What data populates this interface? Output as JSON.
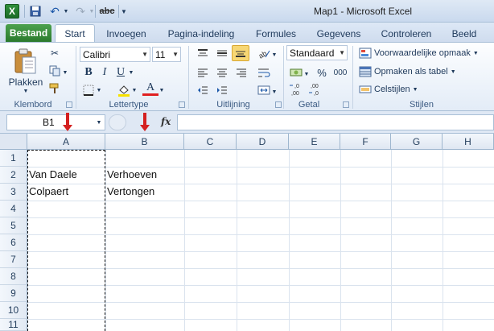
{
  "window": {
    "title": "Map1  -  Microsoft Excel",
    "app_icon_letter": "X"
  },
  "quick_access": {
    "undo_glyph": "↶",
    "redo_glyph": "↷",
    "spell_label": "abc"
  },
  "tabs": [
    {
      "label": "Bestand",
      "kind": "file"
    },
    {
      "label": "Start",
      "active": true
    },
    {
      "label": "Invoegen"
    },
    {
      "label": "Pagina-indeling"
    },
    {
      "label": "Formules"
    },
    {
      "label": "Gegevens"
    },
    {
      "label": "Controleren"
    },
    {
      "label": "Beeld"
    }
  ],
  "ribbon": {
    "clipboard": {
      "paste_label": "Plakken",
      "group_label": "Klembord"
    },
    "font": {
      "name": "Calibri",
      "size": "11",
      "group_label": "Lettertype",
      "bold": "B",
      "italic": "I",
      "underline": "U",
      "font_color_glyph": "A"
    },
    "alignment": {
      "group_label": "Uitlijning"
    },
    "number": {
      "format": "Standaard",
      "group_label": "Getal",
      "currency": "$",
      "percent": "%",
      "thousands": "000",
      "inc_decimal": "←,0\n,00",
      "dec_decimal": ",00\n→,0"
    },
    "styles": {
      "group_label": "Stijlen",
      "conditional": "Voorwaardelijke opmaak",
      "as_table": "Opmaken als tabel",
      "cell_styles": "Celstijlen"
    }
  },
  "formula_bar": {
    "name_box": "B1",
    "fx": "fx",
    "value": ""
  },
  "sheet": {
    "columns": [
      "A",
      "B",
      "C",
      "D",
      "E",
      "F",
      "G",
      "H"
    ],
    "rows": [
      "1",
      "2",
      "3",
      "4",
      "5",
      "6",
      "7",
      "8",
      "9",
      "10",
      "11"
    ],
    "cells": {
      "A2": "Van Daele",
      "B2": "Verhoeven",
      "A3": "Colpaert",
      "B3": "Vertongen"
    }
  },
  "colors": {
    "file_tab": "#2b7a2d",
    "annotation_arrow": "#d42020",
    "highlight": "#f7d774"
  }
}
